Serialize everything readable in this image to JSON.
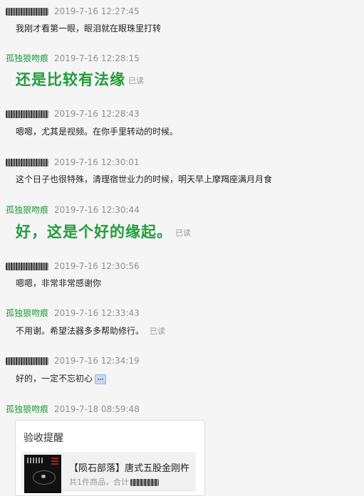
{
  "messages": [
    {
      "sender": "",
      "time": "2019-7-16 12:27:45",
      "text": "我刚才看第一眼，眼泪就在眼珠里打转"
    },
    {
      "sender": "孤独狼吻痕",
      "time": "2019-7-16 12:28:15",
      "text": "还是比较有法缘",
      "read": "已读"
    },
    {
      "sender": "",
      "time": "2019-7-16 12:28:43",
      "text": "嗯嗯，尤其是视频。在你手里转动的时候。"
    },
    {
      "sender": "",
      "time": "2019-7-16 12:30:01",
      "text": "这个日子也很特殊，清理宿世业力的时候，明天早上摩羯座满月月食"
    },
    {
      "sender": "孤独狼吻痕",
      "time": "2019-7-16 12:30:44",
      "text": "好，这是个好的缘起。",
      "read": "已读"
    },
    {
      "sender": "",
      "time": "2019-7-16 12:30:56",
      "text": "嗯嗯，非常非常感谢你"
    },
    {
      "sender": "孤独狼吻痕",
      "time": "2019-7-16 12:33:43",
      "text": "不用谢。希望法器多多帮助修行。",
      "read": "已读"
    },
    {
      "sender": "",
      "time": "2019-7-16 12:34:19",
      "text": "好的，一定不忘初心"
    },
    {
      "sender": "孤独狼吻痕",
      "time": "2019-7-18 08:59:48"
    }
  ],
  "card": {
    "title": "验收提醒",
    "product_name": "【陨石部落】唐式五股金刚杵",
    "summary": "共1件商品，合计"
  },
  "icons": {
    "emoji": "emoji-icon",
    "thumbnail": "product-thumbnail"
  },
  "colors": {
    "sender": "#1f9d3a",
    "time": "#8f8f8f",
    "background": "#f5f5f5"
  }
}
